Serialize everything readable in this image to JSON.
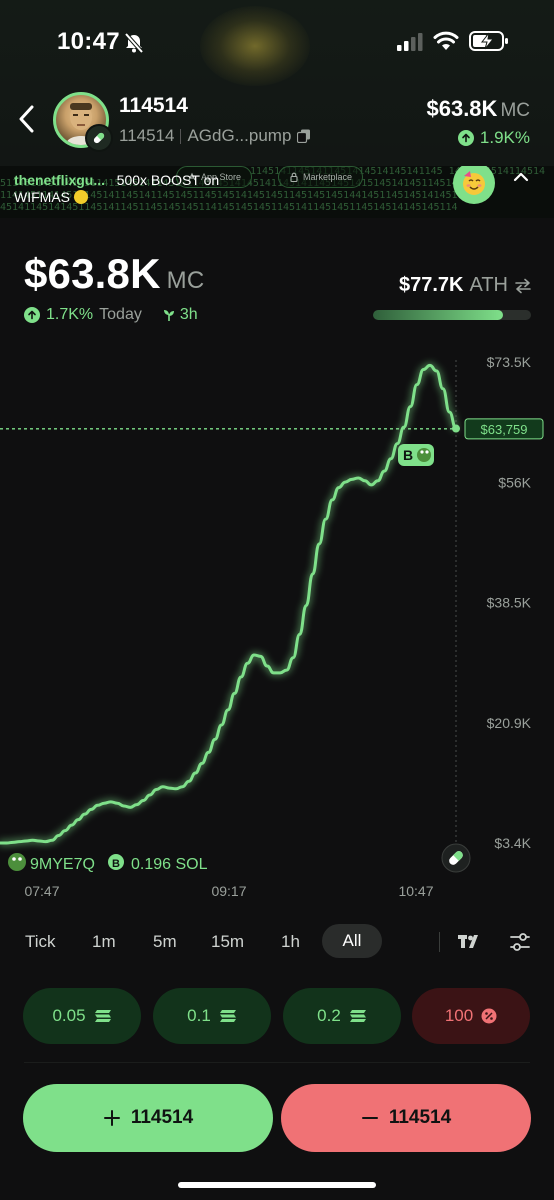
{
  "status": {
    "time": "10:47"
  },
  "header": {
    "token_name": "114514",
    "token_symbol": "114514",
    "contract": "AGdG...pump",
    "market_cap": "$63.8K",
    "mc_unit": "MC",
    "change": "1.9K%"
  },
  "ticker": {
    "user": "thenetflixgu...",
    "text": "500x BOOST on",
    "text2": "WIFMAS",
    "pill_appstore": "App Store",
    "pill_marketplace": "Marketplace"
  },
  "stats": {
    "market_cap": "$63.8K",
    "mc_unit": "MC",
    "today_change": "1.7K%",
    "today_label": "Today",
    "age": "3h",
    "ath_value": "$77.7K",
    "ath_label": "ATH",
    "ath_progress": 0.82
  },
  "chart_data": {
    "type": "line",
    "y_ticks": [
      "$73.5K",
      "$56K",
      "$38.5K",
      "$20.9K",
      "$3.4K"
    ],
    "x_ticks": [
      "07:47",
      "09:17",
      "10:47"
    ],
    "ylim": [
      3.4,
      73.5
    ],
    "y_unit": "K",
    "current_label": "$63,759",
    "current_value": 63.759,
    "trade_badge": "B",
    "trader": "9MYE7Q",
    "trader_badge": "B",
    "trader_amount": "0.196 SOL",
    "x": [
      0,
      2,
      4,
      6,
      8,
      10,
      12,
      14,
      16,
      18,
      20,
      22,
      24,
      26,
      28,
      30,
      32,
      34,
      36,
      38,
      40,
      42,
      44,
      46,
      48,
      50,
      52,
      54,
      56,
      58,
      60,
      62,
      64,
      66,
      68,
      70,
      72,
      74,
      76,
      78,
      80,
      82,
      84,
      86,
      88,
      90,
      92,
      94,
      96,
      98,
      100,
      102,
      104,
      106,
      108,
      110,
      112,
      114,
      116,
      118,
      120,
      122,
      124,
      126,
      128,
      130,
      132,
      134,
      136,
      138,
      140,
      142,
      144,
      146,
      148,
      150,
      152,
      154,
      156,
      158,
      160,
      162,
      164,
      166,
      168,
      170,
      172,
      174,
      176,
      178,
      180,
      182,
      184,
      186,
      188,
      190
    ],
    "y": [
      3.4,
      3.4,
      3.5,
      3.6,
      3.7,
      3.8,
      3.7,
      3.6,
      3.8,
      4.5,
      5.2,
      6.0,
      6.8,
      7.6,
      8.3,
      8.9,
      9.2,
      9.4,
      9.2,
      8.8,
      8.6,
      9.0,
      9.6,
      10.4,
      11.2,
      11.6,
      11.4,
      11.3,
      11.6,
      12.4,
      13.6,
      15.0,
      16.6,
      18.5,
      20.6,
      22.8,
      25.2,
      27.6,
      29.6,
      30.8,
      30.6,
      29.2,
      28.2,
      28.2,
      28.6,
      30.4,
      33.8,
      38.0,
      42.6,
      47.0,
      50.6,
      53.4,
      55.2,
      56.0,
      56.4,
      56.6,
      56.2,
      55.6,
      56.2,
      57.6,
      59.4,
      61.6,
      64.0,
      67.0,
      70.2,
      72.4,
      73.0,
      72.2,
      69.6,
      66.2,
      63.8
    ]
  },
  "intervals": [
    "Tick",
    "1m",
    "5m",
    "15m",
    "1h",
    "All"
  ],
  "quick_buys": [
    "0.05",
    "0.1",
    "0.2"
  ],
  "quick_sell": "100",
  "actions": {
    "buy": "114514",
    "sell": "114514"
  }
}
